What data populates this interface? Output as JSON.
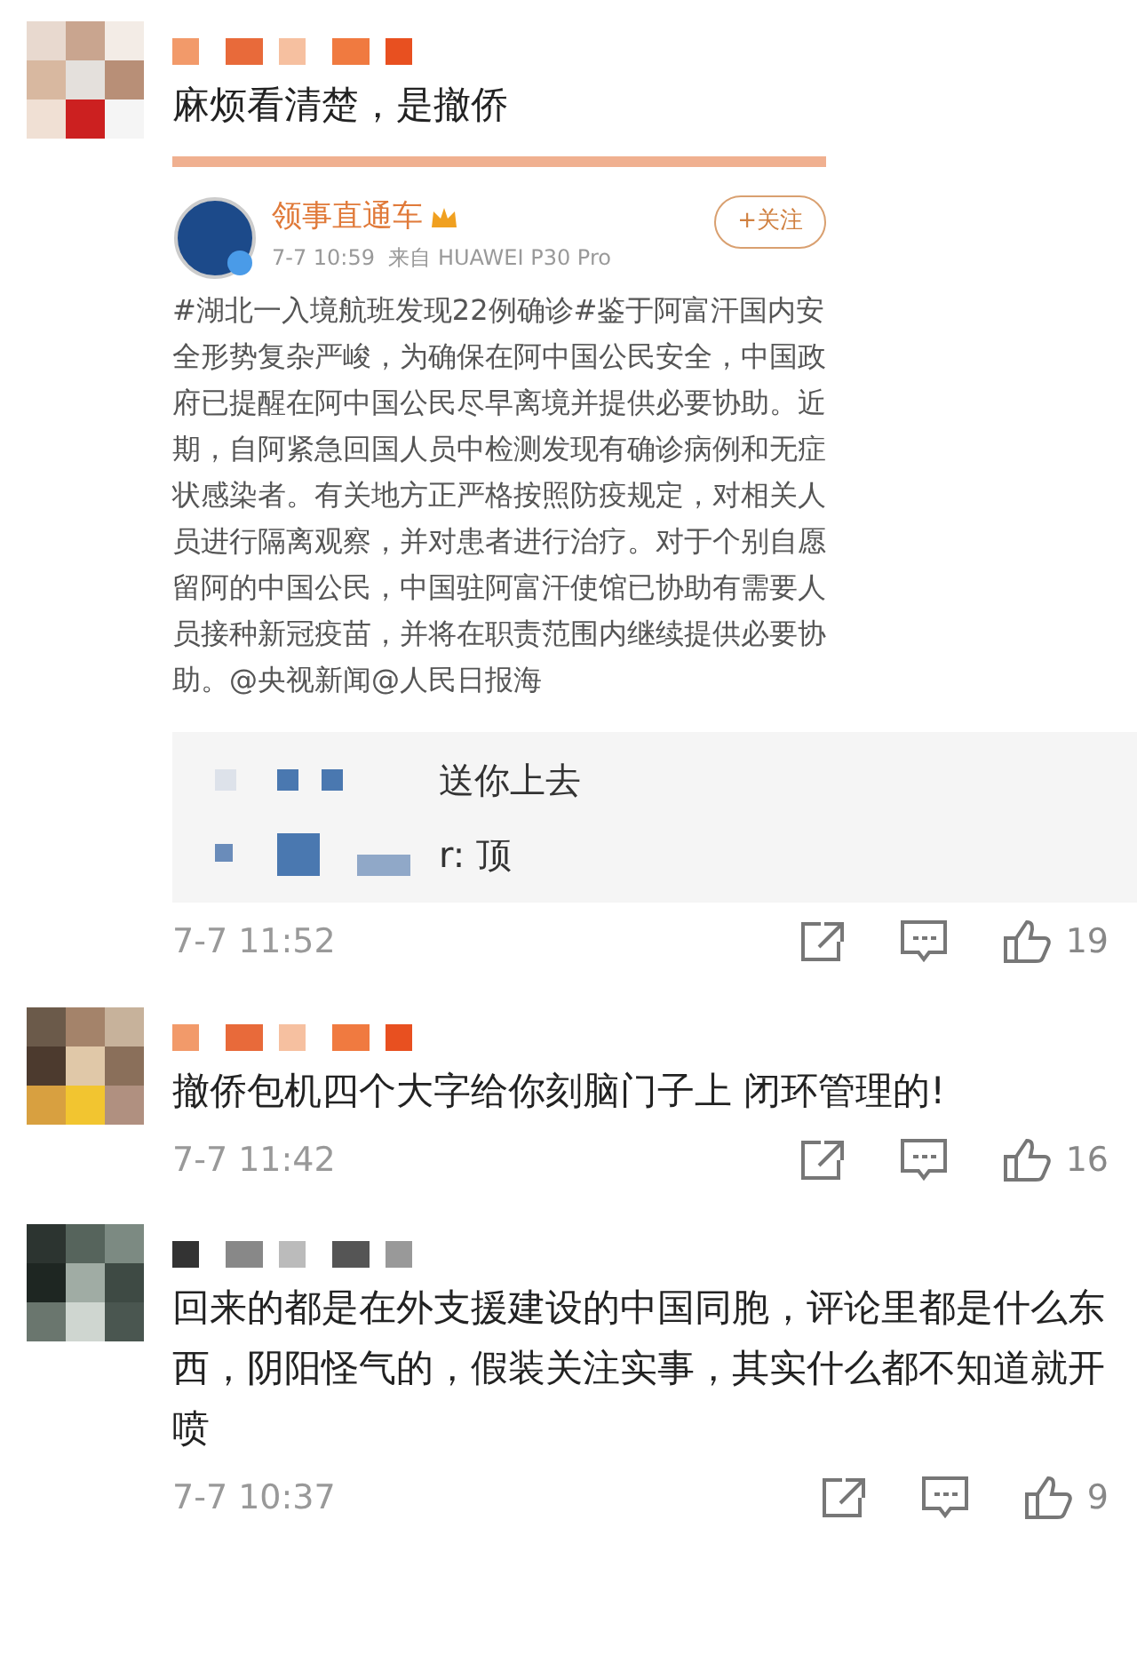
{
  "comments": [
    {
      "text": "麻烦看清楚，是撤侨",
      "embed": {
        "account": "领事直通车",
        "meta": "7-7 10:59  来自 HUAWEI P30 Pro",
        "follow": "+关注",
        "body": "#湖北一入境航班发现22例确诊#鉴于阿富汗国内安全形势复杂严峻，为确保在阿中国公民安全，中国政府已提醒在阿中国公民尽早离境并提供必要协助。近期，自阿紧急回国人员中检测发现有确诊病例和无症状感染者。有关地方正严格按照防疫规定，对相关人员进行隔离观察，并对患者进行治疗。对于个别自愿留阿的中国公民，中国驻阿富汗使馆已协助有需要人员接种新冠疫苗，并将在职责范围内继续提供必要协助。@央视新闻@人民日报海"
      },
      "replies": [
        "送你上去",
        "r: 顶"
      ],
      "time": "7-7 11:52",
      "likes": "19"
    },
    {
      "text": "撤侨包机四个大字给你刻脑门子上 闭环管理的!",
      "time": "7-7 11:42",
      "likes": "16"
    },
    {
      "text": "回来的都是在外支援建设的中国同胞，评论里都是什么东西，阴阳怪气的，假装关注实事，其实什么都不知道就开喷",
      "time": "7-7 10:37",
      "likes": "9"
    }
  ]
}
